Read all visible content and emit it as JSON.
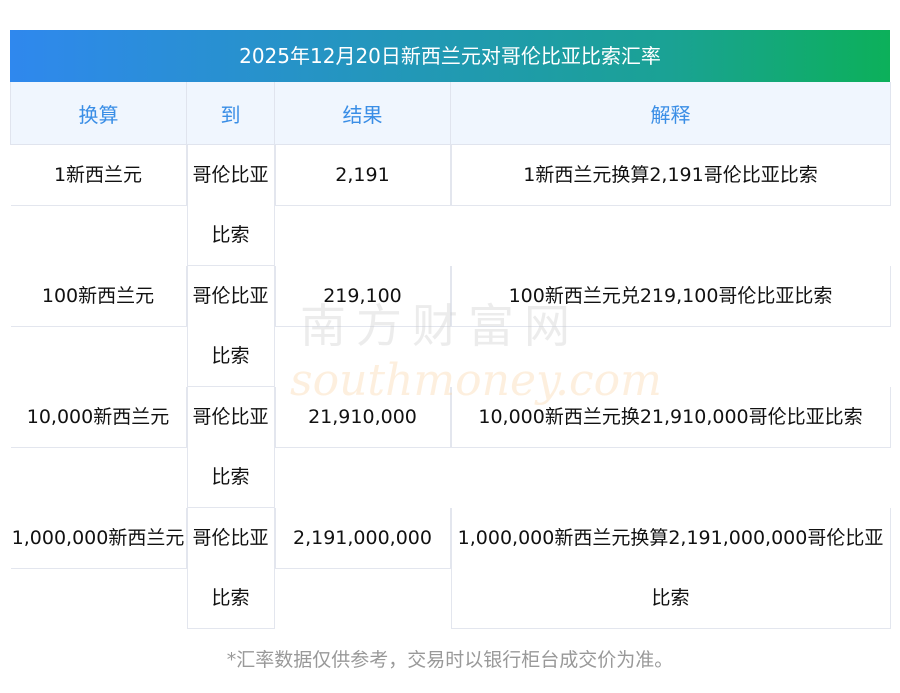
{
  "title": "2025年12月20日新西兰元对哥伦比亚比索汇率",
  "headers": [
    "换算",
    "到",
    "结果",
    "解释"
  ],
  "rows": [
    {
      "from": "1新西兰元",
      "to": "哥伦比亚比索",
      "result": "2,191",
      "explain": "1新西兰元换算2,191哥伦比亚比索"
    },
    {
      "from": "100新西兰元",
      "to": "哥伦比亚比索",
      "result": "219,100",
      "explain": "100新西兰元兑219,100哥伦比亚比索"
    },
    {
      "from": "10,000新西兰元",
      "to": "哥伦比亚比索",
      "result": "21,910,000",
      "explain": "10,000新西兰元换21,910,000哥伦比亚比索"
    },
    {
      "from": "1,000,000新西兰元",
      "to": "哥伦比亚比索",
      "result": "2,191,000,000",
      "explain": "1,000,000新西兰元换算2,191,000,000哥伦比亚比索"
    }
  ],
  "footer": "*汇率数据仅供参考，交易时以银行柜台成交价为准。",
  "watermark": {
    "cn": "南方财富网",
    "en": "southmoney.com"
  }
}
